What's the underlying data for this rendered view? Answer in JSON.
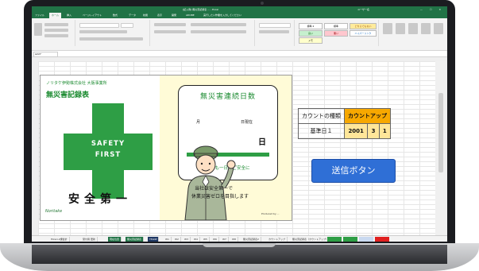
{
  "excel": {
    "title": "[記入例] 無災害記録表 ... - Excel",
    "user": "ユーザー名",
    "window_controls": "— ☐ ✕",
    "ribbon_tabs": [
      "ファイル",
      "ホーム",
      "挿入",
      "ページレイアウト",
      "数式",
      "データ",
      "校閲",
      "表示",
      "開発",
      "ADOBE",
      "実行したい作業を入力してください"
    ],
    "selected_tab": "ホーム",
    "style_cells": [
      "標準 2",
      "標準",
      "どちらでもない",
      "良い",
      "悪い",
      "ハイパーリンク",
      "メモ"
    ],
    "name_box": "A227",
    "sheet_tabs": [
      "Hikari-2課会計",
      "受付用 更新",
      "現在位置",
      "無災害記録表",
      "TELNP",
      "W1",
      "W2",
      "W3",
      "W4",
      "W5",
      "W6",
      "W7",
      "W8",
      "無災害記録表2",
      "カウントアップ",
      "無災害記録表（カウントアップ）"
    ]
  },
  "board": {
    "company": "ノリタケ伊勢株式会社 大阪事業所",
    "title": "無災害記録表",
    "cross_line1": "SAFETY",
    "cross_line2": "FIRST",
    "slogan": "安全第一",
    "brand": "Noritake",
    "counter_title": "無災害連続日数",
    "month_label": "月",
    "asof_label": "日現在",
    "day_unit": "日",
    "today_msg": "今日も一日、ご安全に",
    "msg_line1": "当社は安全第一で",
    "msg_line2": "休業災害ゼロを目指します",
    "credit": "Produced by ..."
  },
  "count_table": {
    "header_label": "カウントの種類",
    "header_value": "カウントアップ",
    "row_label": "基準日１",
    "year": "2001",
    "month": "3",
    "day": "1"
  },
  "send_button": "送信ボタン"
}
